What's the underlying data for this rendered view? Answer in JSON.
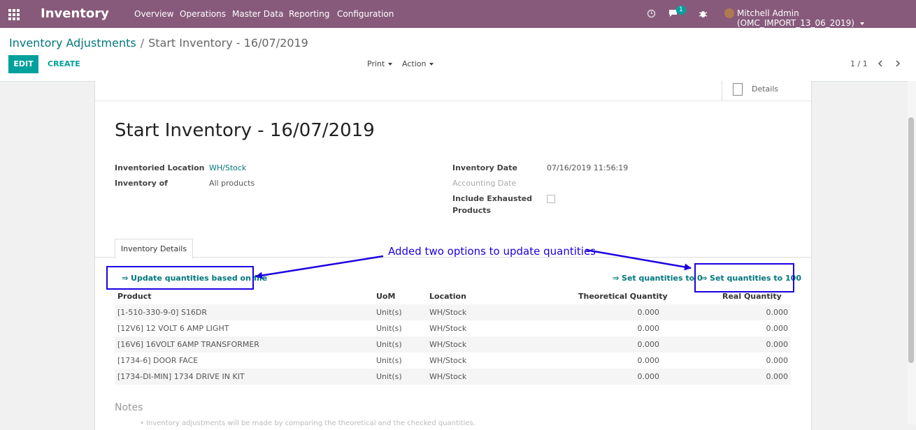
{
  "navbar": {
    "app_name": "Inventory",
    "menu": [
      "Overview",
      "Operations",
      "Master Data",
      "Reporting",
      "Configuration"
    ],
    "badge_count": "1",
    "user": "Mitchell Admin (OMC_IMPORT_13_06_2019)"
  },
  "breadcrumb": {
    "parent": "Inventory Adjustments",
    "separator": "/",
    "current": "Start Inventory - 16/07/2019"
  },
  "toolbar": {
    "edit_label": "EDIT",
    "create_label": "CREATE",
    "print_label": "Print",
    "action_label": "Action",
    "pager": "1 / 1"
  },
  "record": {
    "details_label": "Details",
    "title": "Start Inventory - 16/07/2019",
    "fields": {
      "location_label": "Inventoried Location",
      "location_value": "WH/Stock",
      "inventory_of_label": "Inventory of",
      "inventory_of_value": "All products",
      "date_label": "Inventory Date",
      "date_value": "07/16/2019 11:56:19",
      "accounting_date_label": "Accounting Date",
      "exhausted_label_1": "Include Exhausted",
      "exhausted_label_2": "Products"
    },
    "tab_label": "Inventory Details",
    "actions": {
      "update_file": "⇒ Update quantities based on file",
      "set_zero": "⇒ Set quantities to 0",
      "set_hundred": "⇒ Set quantities to 100"
    },
    "columns": [
      "Product",
      "UoM",
      "Location",
      "Theoretical Quantity",
      "Real Quantity"
    ],
    "lines": [
      {
        "product": "[1-510-330-9-0] S16DR",
        "uom": "Unit(s)",
        "location": "WH/Stock",
        "theoretical": "0.000",
        "real": "0.000"
      },
      {
        "product": "[12V6] 12 VOLT 6 AMP LIGHT",
        "uom": "Unit(s)",
        "location": "WH/Stock",
        "theoretical": "0.000",
        "real": "0.000"
      },
      {
        "product": "[16V6] 16VOLT 6AMP TRANSFORMER",
        "uom": "Unit(s)",
        "location": "WH/Stock",
        "theoretical": "0.000",
        "real": "0.000"
      },
      {
        "product": "[1734-6] DOOR FACE",
        "uom": "Unit(s)",
        "location": "WH/Stock",
        "theoretical": "0.000",
        "real": "0.000"
      },
      {
        "product": "[1734-DI-MIN] 1734 DRIVE IN KIT",
        "uom": "Unit(s)",
        "location": "WH/Stock",
        "theoretical": "0.000",
        "real": "0.000"
      }
    ],
    "notes_title": "Notes",
    "notes_line": "• Inventory adjustments will be made by comparing the theoretical and the checked quantities."
  },
  "annotation": {
    "text": "Added two options to update quantities",
    "color": "#1b00e0"
  }
}
